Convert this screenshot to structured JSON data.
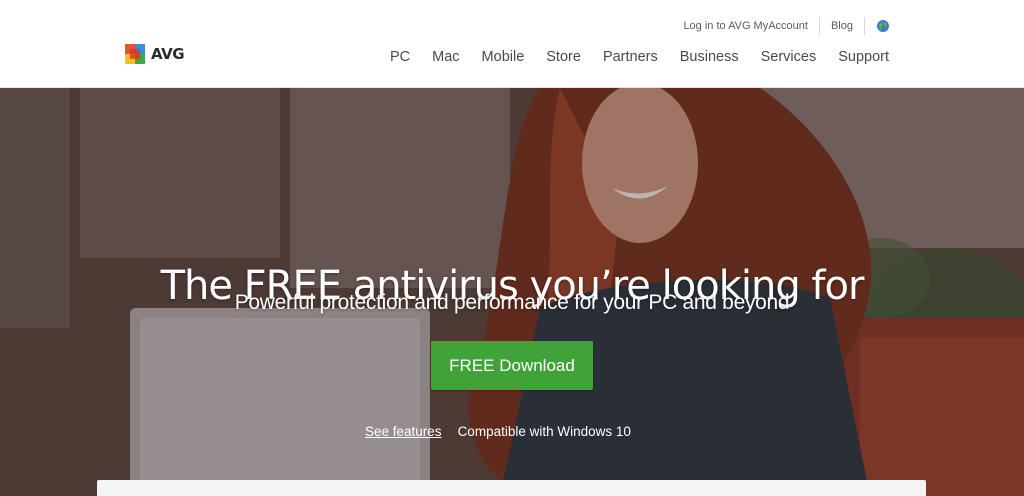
{
  "header": {
    "brand": "AVG",
    "utility": {
      "login_label": "Log in to AVG MyAccount",
      "blog_label": "Blog",
      "globe_icon": "globe-icon"
    },
    "nav": [
      "PC",
      "Mac",
      "Mobile",
      "Store",
      "Partners",
      "Business",
      "Services",
      "Support"
    ]
  },
  "hero": {
    "title": "The FREE antivirus you’re looking for",
    "subtitle": "Powerful protection and performance for your PC and beyond",
    "cta_label": "FREE Download",
    "see_features_label": "See features",
    "compat_text": "Compatible with Windows 10"
  },
  "colors": {
    "cta_green": "#3fa33a",
    "nav_text": "#444b54"
  }
}
